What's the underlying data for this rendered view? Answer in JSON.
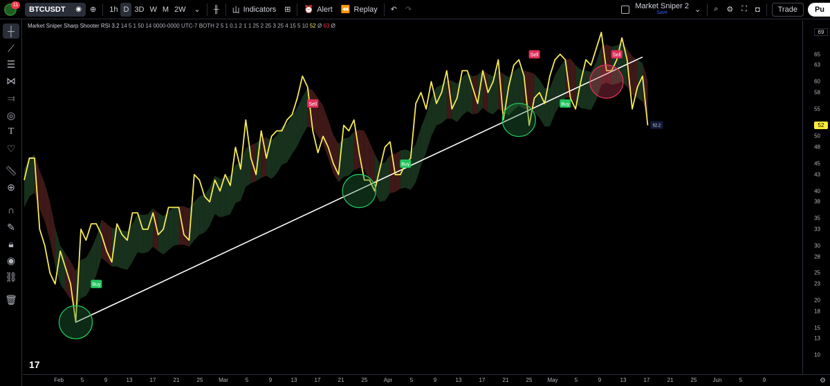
{
  "toolbar": {
    "notif_count": "11",
    "symbol": "BTCUSDT",
    "intervals": [
      "1h",
      "D",
      "3D",
      "W",
      "M",
      "2W"
    ],
    "active_interval": "D",
    "indicators_label": "Indicators",
    "alert_label": "Alert",
    "replay_label": "Replay",
    "layout_name": "Market Sniper 2",
    "layout_save": "Save",
    "trade_label": "Trade",
    "publish_label": "Pu"
  },
  "legend": {
    "indicator_name": "Market Sniper Sharp Shooter RSI 3.2",
    "params": "14 5 1 50 14 0000-0000 UTC-7 BOTH 2 5 1 0.1 2 1 1 25 2 25 3 25 4 15 5 10",
    "value1": "52",
    "symbol1": "Ø",
    "value2": "63",
    "symbol2": "Ø"
  },
  "price_axis": {
    "ticks": [
      "69",
      "65",
      "63",
      "60",
      "58",
      "55",
      "52",
      "50",
      "48",
      "45",
      "43",
      "40",
      "38",
      "35",
      "33",
      "30",
      "28",
      "25",
      "23",
      "20",
      "18",
      "15",
      "13",
      "10"
    ],
    "last_value": "52",
    "max_value": "69"
  },
  "time_axis": {
    "ticks": [
      "Feb",
      "5",
      "9",
      "13",
      "17",
      "21",
      "25",
      "Mar",
      "5",
      "9",
      "13",
      "17",
      "21",
      "25",
      "Apr",
      "5",
      "9",
      "13",
      "17",
      "21",
      "25",
      "May",
      "5",
      "9",
      "13",
      "17",
      "21",
      "25",
      "Jun",
      "5",
      "9"
    ]
  },
  "chart_data": {
    "type": "line",
    "title": "Market Sniper Sharp Shooter RSI 3.2",
    "ylim": [
      8,
      70
    ],
    "rsi": [
      42,
      46,
      46,
      33,
      30,
      25,
      23,
      29,
      26,
      23,
      16,
      33,
      31,
      34,
      34,
      32,
      29,
      27,
      34,
      32,
      31,
      36,
      36,
      33,
      33,
      36,
      32,
      33,
      37,
      37,
      37,
      32,
      31,
      43,
      42,
      39,
      38,
      42,
      40,
      43,
      41,
      48,
      44,
      53,
      46,
      43,
      51,
      46,
      50,
      51,
      51,
      53,
      54,
      57,
      61,
      59,
      51,
      47,
      50,
      48,
      45,
      43,
      52,
      51,
      53,
      47,
      42,
      42,
      40,
      44,
      48,
      49,
      43,
      43,
      45,
      46,
      56,
      58,
      55,
      60,
      56,
      58,
      62,
      55,
      57,
      62,
      62,
      59,
      56,
      62,
      58,
      60,
      64,
      53,
      59,
      63,
      64,
      61,
      52,
      57,
      58,
      56,
      61,
      64,
      65,
      64,
      57,
      55,
      60,
      64,
      63,
      66,
      69,
      62,
      62,
      64,
      68,
      64,
      55,
      59,
      61,
      52
    ],
    "trendline": {
      "x": [
        10,
        120
      ],
      "y": [
        16,
        64.5
      ]
    },
    "signals": [
      {
        "label": "Buy",
        "type": "buy",
        "x": 14,
        "y": 23
      },
      {
        "label": "Sell",
        "type": "sell",
        "x": 56,
        "y": 56
      },
      {
        "label": "Buy",
        "type": "buy",
        "x": 74,
        "y": 45
      },
      {
        "label": "Sell",
        "type": "sell",
        "x": 99,
        "y": 65
      },
      {
        "label": "Buy",
        "type": "buy",
        "x": 105,
        "y": 56
      },
      {
        "label": "Sell",
        "type": "sell",
        "x": 115,
        "y": 65
      }
    ],
    "circles": [
      {
        "type": "buy",
        "x": 10,
        "y": 16
      },
      {
        "type": "buy",
        "x": 65,
        "y": 40
      },
      {
        "type": "buy",
        "x": 96,
        "y": 53
      },
      {
        "type": "sell",
        "x": 113,
        "y": 60
      }
    ],
    "last_label": "52.2",
    "colors": {
      "rsi": "#f7ea5a",
      "trend": "#ffffff",
      "bull_band": "#1c3a22",
      "bear_band": "#4a1c1c",
      "buy": "#22c55e",
      "sell": "#e0315c"
    }
  }
}
